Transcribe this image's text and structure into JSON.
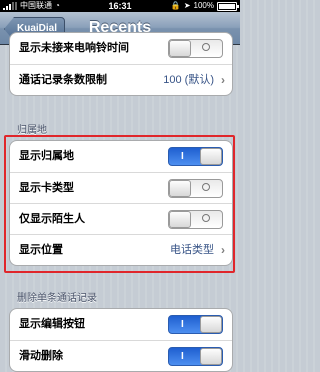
{
  "status_bar": {
    "carrier": "中国联通",
    "time": "16:31",
    "battery": "100%"
  },
  "nav": {
    "title": "Recents",
    "back_label": "KuaiDial"
  },
  "group_top": {
    "rows": [
      {
        "label": "显示未接来电响铃时间",
        "type": "switch",
        "on": false
      },
      {
        "label": "通话记录条数限制",
        "value": "100 (默认)",
        "type": "disclosure"
      }
    ]
  },
  "section_guishu": {
    "header": "归属地",
    "rows": [
      {
        "label": "显示归属地",
        "type": "switch",
        "on": true
      },
      {
        "label": "显示卡类型",
        "type": "switch",
        "on": false
      },
      {
        "label": "仅显示陌生人",
        "type": "switch",
        "on": false
      },
      {
        "label": "显示位置",
        "value": "电话类型",
        "type": "disclosure"
      }
    ]
  },
  "section_delete": {
    "header": "删除单条通话记录",
    "rows": [
      {
        "label": "显示编辑按钮",
        "type": "switch",
        "on": true
      },
      {
        "label": "滑动删除",
        "type": "switch",
        "on": true
      }
    ]
  },
  "colors": {
    "switch_on": "#3a7ae8",
    "highlight_border": "#e0262b",
    "value_text": "#385487"
  }
}
